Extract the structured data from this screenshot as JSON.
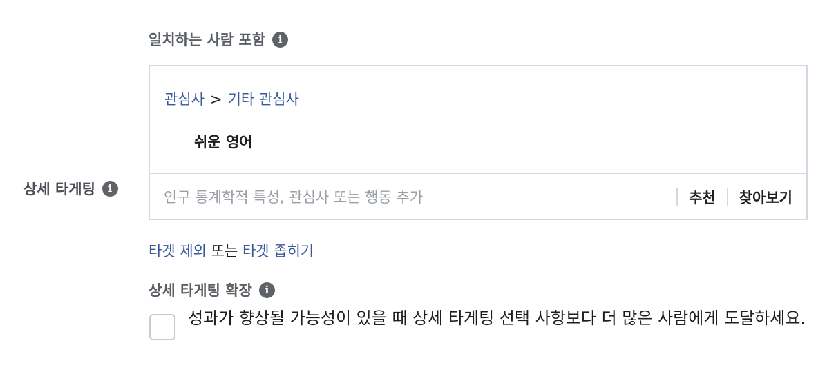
{
  "include": {
    "label": "일치하는 사람 포함",
    "info_icon": "i"
  },
  "detailed_targeting": {
    "label": "상세 타게팅",
    "info_icon": "i"
  },
  "selection": {
    "breadcrumb_parent": "관심사",
    "breadcrumb_separator": ">",
    "breadcrumb_child": "기타 관심사",
    "selected_item": "쉬운 영어"
  },
  "search": {
    "placeholder": "인구 통계학적 특성, 관심사 또는 행동 추가",
    "value": "",
    "suggest_label": "추천",
    "browse_label": "찾아보기"
  },
  "links": {
    "exclude_label": "타겟 제외",
    "or_text": " 또는 ",
    "narrow_label": "타겟 좁히기"
  },
  "expansion": {
    "label": "상세 타게팅 확장",
    "info_icon": "i",
    "checkbox_checked": false,
    "checkbox_text": "성과가 향상될 가능성이 있을 때 상세 타게팅 선택 사항보다 더 많은 사람에게 도달하세요."
  },
  "colors": {
    "link": "#3b5998",
    "border": "#d3d9e3",
    "muted_text": "#5a5f66",
    "placeholder": "#9a9fa6"
  }
}
